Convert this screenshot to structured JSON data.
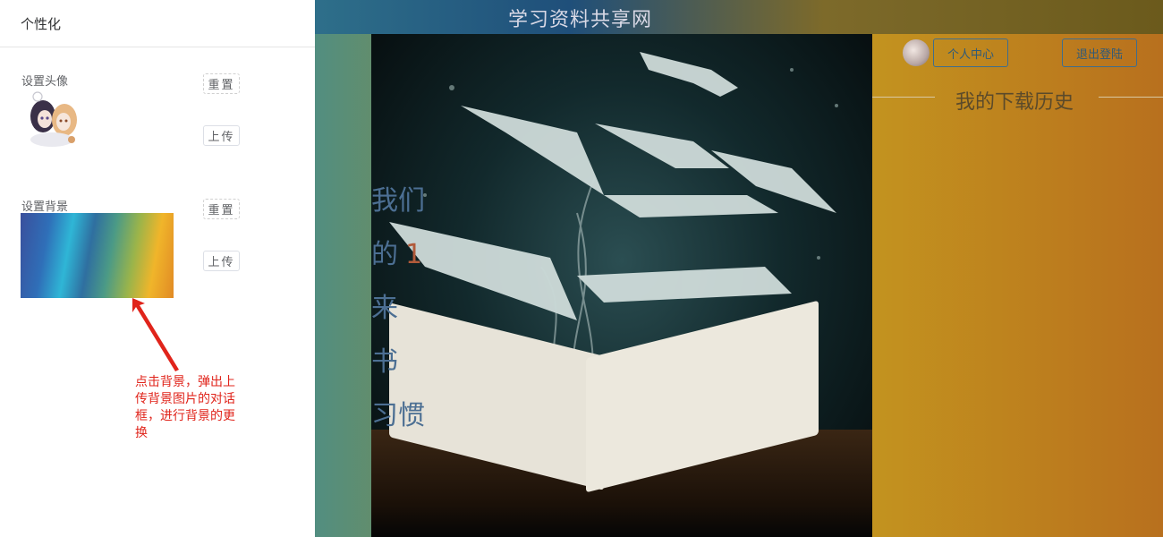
{
  "site": {
    "title": "学习资料共享网"
  },
  "hero": {
    "words": [
      "我们",
      "的",
      "来",
      "书",
      "习惯"
    ],
    "number": "1"
  },
  "header": {
    "center_label": "个人中心",
    "logout_label": "退出登陆"
  },
  "history": {
    "title": "我的下载历史"
  },
  "drawer": {
    "title": "个性化",
    "avatar_section": {
      "label": "设置头像",
      "reset_label": "重置",
      "upload_label": "上传"
    },
    "background_section": {
      "label": "设置背景",
      "reset_label": "重置",
      "upload_label": "上传"
    }
  },
  "annotation": {
    "text": "点击背景，弹出上传背景图片的对话框，进行背景的更换",
    "color": "#e0241b"
  },
  "colors": {
    "accent": "#3e6d8d",
    "drawer_bg": "#ffffff"
  }
}
